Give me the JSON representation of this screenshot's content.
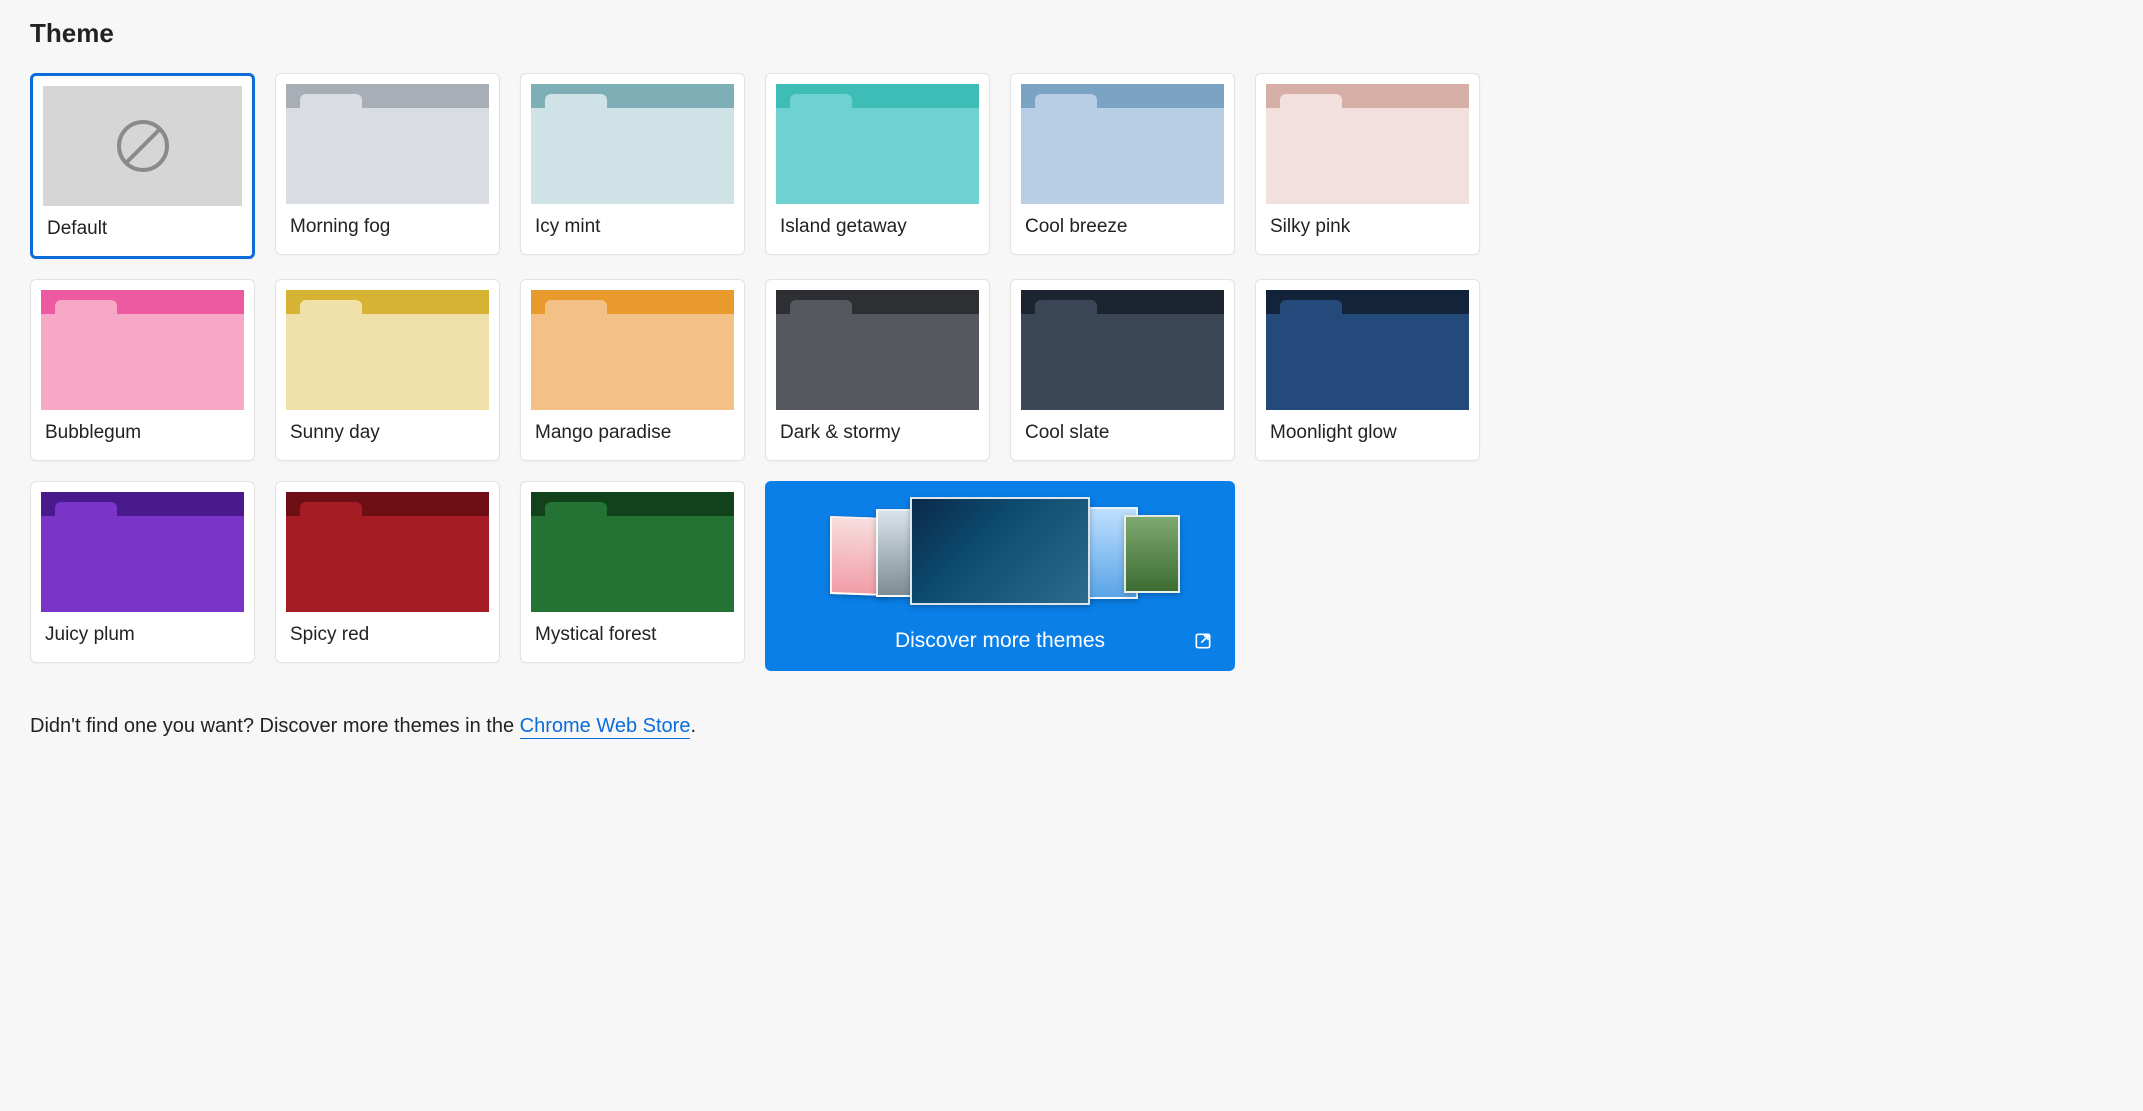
{
  "section_title": "Theme",
  "selected_index": 0,
  "themes": [
    {
      "id": "default",
      "label": "Default",
      "stripe": "#d6d6d6",
      "tab": "#d6d6d6",
      "body": "#d6d6d6",
      "is_default": true
    },
    {
      "id": "morning-fog",
      "label": "Morning fog",
      "stripe": "#a8aeb5",
      "tab": "#d9dce1",
      "body": "#d9dce1"
    },
    {
      "id": "icy-mint",
      "label": "Icy mint",
      "stripe": "#7eafb6",
      "tab": "#cfe3e6",
      "body": "#cfe3e6"
    },
    {
      "id": "island-getaway",
      "label": "Island getaway",
      "stripe": "#3ebdb7",
      "tab": "#6fd2d0",
      "body": "#6fd2d0"
    },
    {
      "id": "cool-breeze",
      "label": "Cool breeze",
      "stripe": "#7ba3c4",
      "tab": "#b7cee4",
      "body": "#b7cee4"
    },
    {
      "id": "silky-pink",
      "label": "Silky pink",
      "stripe": "#d5aea5",
      "tab": "#f1e0de",
      "body": "#f1e0de"
    },
    {
      "id": "bubblegum",
      "label": "Bubblegum",
      "stripe": "#ee5aa1",
      "tab": "#f7a8c7",
      "body": "#f7a8c7"
    },
    {
      "id": "sunny-day",
      "label": "Sunny day",
      "stripe": "#d6b333",
      "tab": "#f0e0a9",
      "body": "#f0e0a9"
    },
    {
      "id": "mango-paradise",
      "label": "Mango paradise",
      "stripe": "#e99a2c",
      "tab": "#f3c185",
      "body": "#f3c185"
    },
    {
      "id": "dark-stormy",
      "label": "Dark & stormy",
      "stripe": "#2d2f33",
      "tab": "#55585e",
      "body": "#55585e"
    },
    {
      "id": "cool-slate",
      "label": "Cool slate",
      "stripe": "#1c2430",
      "tab": "#3b4656",
      "body": "#3b4656"
    },
    {
      "id": "moonlight-glow",
      "label": "Moonlight glow",
      "stripe": "#13233a",
      "tab": "#234a7a",
      "body": "#234a7a"
    },
    {
      "id": "juicy-plum",
      "label": "Juicy plum",
      "stripe": "#4a1a8c",
      "tab": "#7a34c8",
      "body": "#7a34c8"
    },
    {
      "id": "spicy-red",
      "label": "Spicy red",
      "stripe": "#6e0f16",
      "tab": "#a51c24",
      "body": "#a51c24"
    },
    {
      "id": "mystical-forest",
      "label": "Mystical forest",
      "stripe": "#11421c",
      "tab": "#257235",
      "body": "#257235"
    }
  ],
  "discover": {
    "label": "Discover more themes"
  },
  "footer": {
    "prefix": "Didn't find one you want? Discover more themes in the ",
    "link_text": "Chrome Web Store",
    "suffix": "."
  }
}
